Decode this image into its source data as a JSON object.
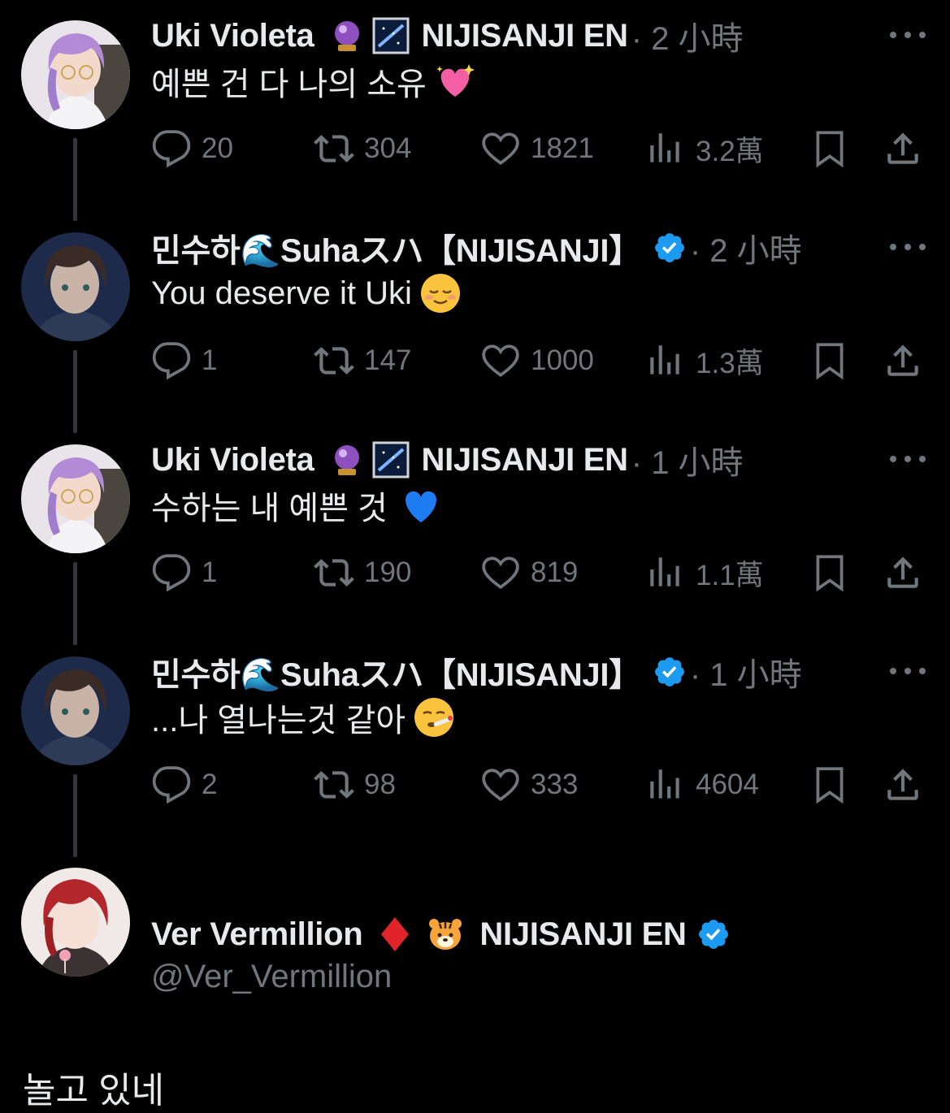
{
  "thread": [
    {
      "name": "Uki Violeta",
      "emojis": [
        "crystal-ball",
        "milky-way"
      ],
      "affiliation": "NIJISANJI EN",
      "verified": false,
      "time": "· 2 小時",
      "text": "예쁜 건 다 나의 소유",
      "text_emoji": "sparkling-heart",
      "replies": "20",
      "retweets": "304",
      "likes": "1821",
      "views": "3.2萬"
    },
    {
      "name": "민수하🌊Suhaスハ【NIJISANJI】",
      "emojis": [],
      "affiliation": "",
      "verified": true,
      "time": "· 2 小時",
      "text": "You deserve it Uki",
      "text_emoji": "relieved-face",
      "replies": "1",
      "retweets": "147",
      "likes": "1000",
      "views": "1.3萬"
    },
    {
      "name": "Uki Violeta",
      "emojis": [
        "crystal-ball",
        "milky-way"
      ],
      "affiliation": "NIJISANJI EN",
      "verified": false,
      "time": "· 1 小時",
      "text": "수하는 내 예쁜 것",
      "text_emoji": "blue-heart",
      "replies": "1",
      "retweets": "190",
      "likes": "819",
      "views": "1.1萬"
    },
    {
      "name": "민수하🌊Suhaスハ【NIJISANJI】",
      "emojis": [],
      "affiliation": "",
      "verified": true,
      "time": "· 1 小時",
      "text": "...나 열나는것 같아",
      "text_emoji": "thermometer-face",
      "replies": "2",
      "retweets": "98",
      "likes": "333",
      "views": "4604"
    }
  ],
  "main": {
    "name": "Ver Vermillion",
    "emojis": [
      "red-diamond",
      "tiger-face"
    ],
    "affiliation": "NIJISANJI EN",
    "verified": true,
    "handle": "@Ver_Vermillion",
    "text": "놀고 있네"
  },
  "colors": {
    "background": "#000000",
    "text": "#e7e9ea",
    "muted": "#71767b",
    "verified": "#1d9bf0",
    "thread_line": "#333639"
  }
}
